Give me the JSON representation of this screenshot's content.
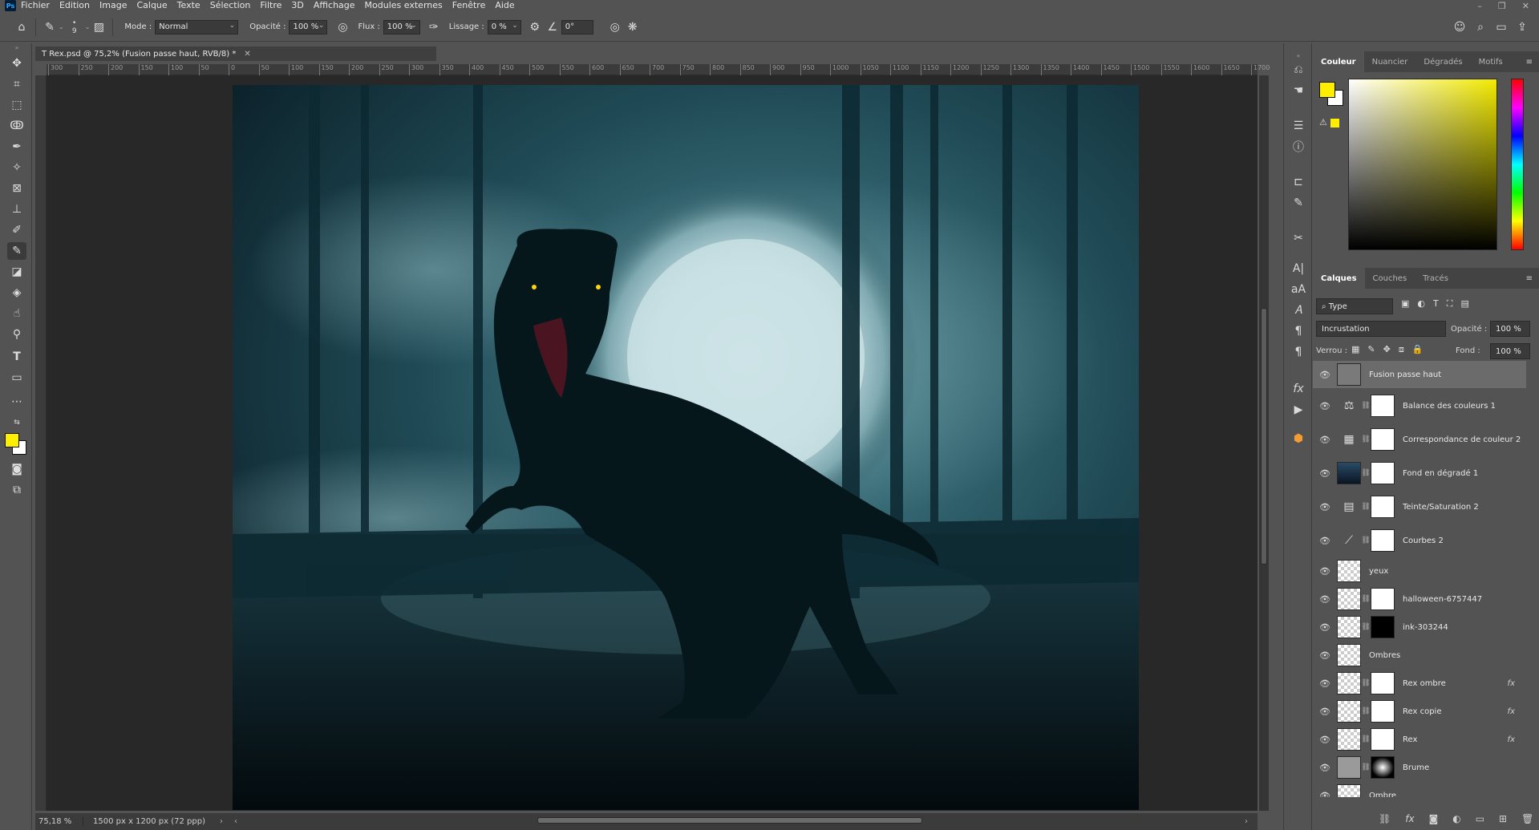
{
  "menu": {
    "logo": "Ps",
    "items": [
      "Fichier",
      "Edition",
      "Image",
      "Calque",
      "Texte",
      "Sélection",
      "Filtre",
      "3D",
      "Affichage",
      "Modules externes",
      "Fenêtre",
      "Aide"
    ]
  },
  "options": {
    "brush_size": "9",
    "mode_label": "Mode :",
    "mode_value": "Normal",
    "opacity_label": "Opacité :",
    "opacity_value": "100 %",
    "flux_label": "Flux :",
    "flux_value": "100 %",
    "smoothing_label": "Lissage :",
    "smoothing_value": "0 %",
    "angle_value": "0°"
  },
  "document": {
    "tab_title": "T Rex.psd @ 75,2% (Fusion passe haut, RVB/8) *",
    "zoom": "75,18 %",
    "info": "1500 px x 1200 px (72 ppp)"
  },
  "ruler": {
    "h_ticks": [
      "300",
      "250",
      "200",
      "150",
      "100",
      "50",
      "0",
      "50",
      "100",
      "150",
      "200",
      "250",
      "300",
      "350",
      "400",
      "450",
      "500",
      "550",
      "600",
      "650",
      "700",
      "750",
      "800",
      "850",
      "900",
      "950",
      "1000",
      "1050",
      "1100",
      "1150",
      "1200",
      "1250",
      "1300",
      "1350",
      "1400",
      "1450",
      "1500",
      "1550",
      "1600",
      "1650",
      "1700"
    ]
  },
  "color_panel": {
    "tabs": [
      "Couleur",
      "Nuancier",
      "Dégradés",
      "Motifs"
    ],
    "foreground": "#ffee00",
    "background": "#ffffff"
  },
  "layers_panel": {
    "tabs": [
      "Calques",
      "Couches",
      "Tracés"
    ],
    "filter": "Type",
    "blend_mode": "Incrustation",
    "opacity_label": "Opacité :",
    "opacity_value": "100 %",
    "lock_label": "Verrou :",
    "fill_label": "Fond :",
    "fill_value": "100 %",
    "layers": [
      {
        "name": "Fusion passe haut",
        "kind": "gray",
        "selected": true
      },
      {
        "name": "Balance des couleurs 1",
        "kind": "adjust",
        "icon": "balance-icon"
      },
      {
        "name": "Correspondance de couleur 2",
        "kind": "adjust",
        "icon": "grid-icon"
      },
      {
        "name": "Fond en dégradé 1",
        "kind": "gradient"
      },
      {
        "name": "Teinte/Saturation 2",
        "kind": "adjust",
        "icon": "hue-icon"
      },
      {
        "name": "Courbes 2",
        "kind": "adjust",
        "icon": "curves-icon"
      },
      {
        "name": "yeux",
        "kind": "empty"
      },
      {
        "name": "halloween-6757447",
        "kind": "smart"
      },
      {
        "name": "ink-303244",
        "kind": "smart-dark"
      },
      {
        "name": "Ombres",
        "kind": "empty"
      },
      {
        "name": "Rex ombre",
        "kind": "smart",
        "fx": "fx"
      },
      {
        "name": "Rex copie",
        "kind": "smart",
        "fx": "fx"
      },
      {
        "name": "Rex",
        "kind": "smart",
        "fx": "fx"
      },
      {
        "name": "Brume",
        "kind": "brume"
      },
      {
        "name": "Ombre",
        "kind": "empty"
      }
    ]
  }
}
